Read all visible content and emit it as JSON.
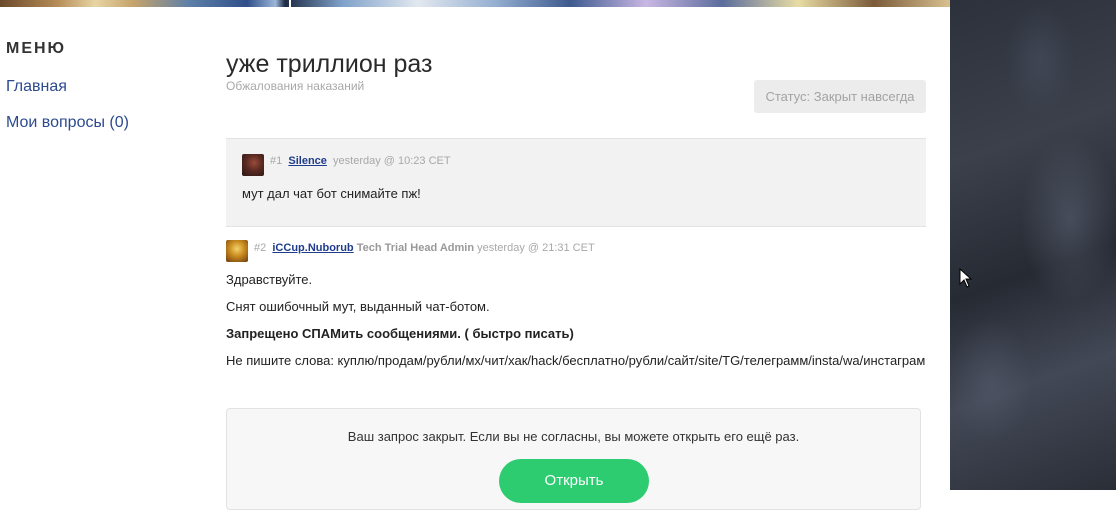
{
  "sidebar": {
    "title": "МЕНЮ",
    "items": [
      {
        "label": "Главная"
      },
      {
        "label": "Мои вопросы (0)"
      }
    ]
  },
  "ticket": {
    "title": "уже триллион раз",
    "category": "Обжалования наказаний",
    "status": "Статус: Закрыт навсегда"
  },
  "posts": [
    {
      "number": "#1",
      "author": "Silence",
      "role": "",
      "time": "yesterday @ 10:23 CET",
      "lines": [
        "мут дал чат бот снимайте пж!"
      ]
    },
    {
      "number": "#2",
      "author": "iCCup.Nuborub",
      "role": "Tech Trial Head Admin",
      "time": "yesterday @ 21:31 CET",
      "lines": [
        "Здравствуйте.",
        "Снят ошибочный мут, выданный чат-ботом.",
        "Запрещено СПАМить сообщениями. ( быстро писать)",
        "Не пишите слова: куплю/продам/рубли/мх/чит/хак/hack/бесплатно/рубли/сайт/site/TG/телеграмм/insta/wa/инстаграм"
      ]
    }
  ],
  "closed": {
    "message": "Ваш запрос закрыт. Если вы не согласны, вы можете открыть его ещё раз.",
    "open_label": "Открыть"
  },
  "colors": {
    "link": "#2c4a8f",
    "author": "#1f3c8c",
    "accent_green": "#2ecc71",
    "status_bg": "#ececec"
  }
}
